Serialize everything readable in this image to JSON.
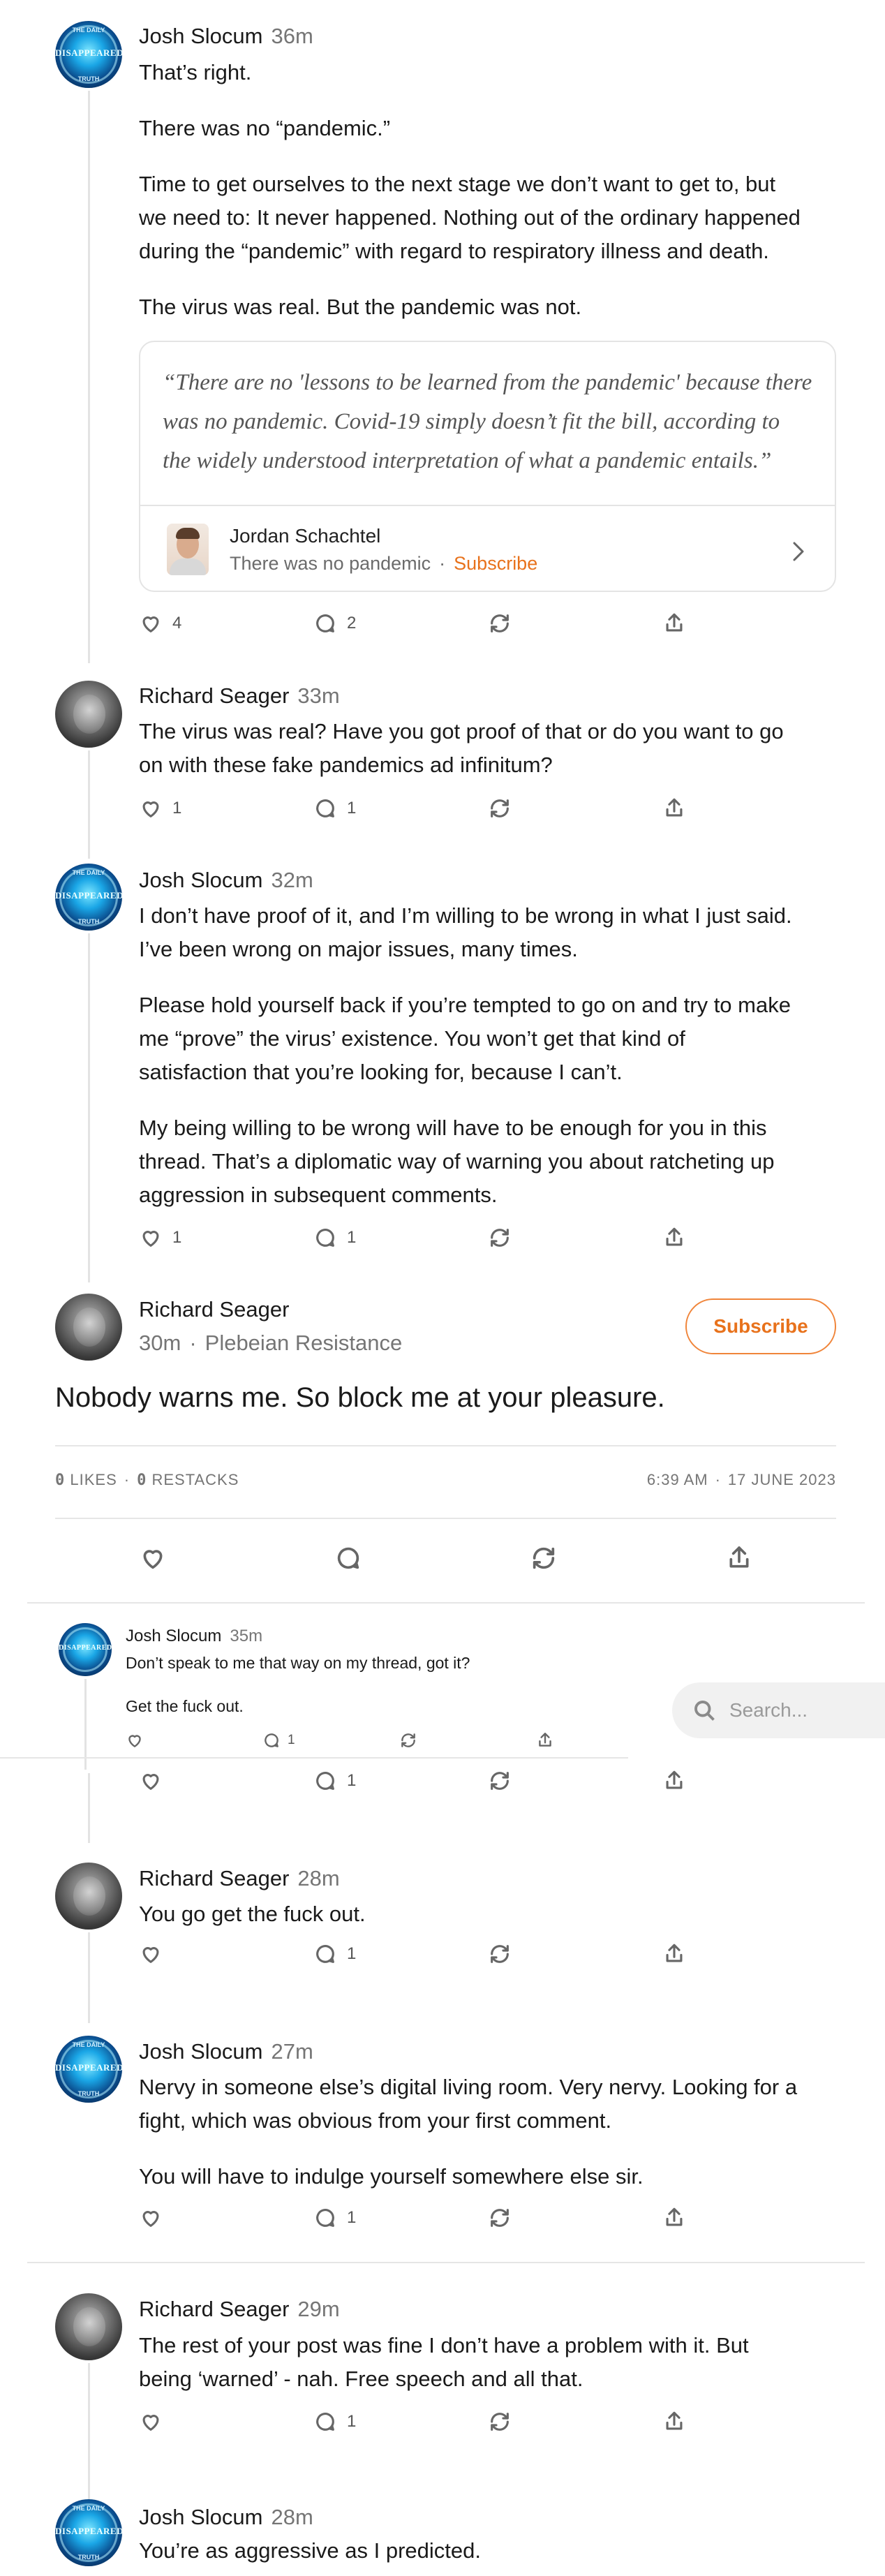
{
  "comments": [
    {
      "author": "Josh Slocum",
      "time": "36m",
      "paragraphs": [
        "That’s right.",
        "There was no “pandemic.”",
        "Time to get ourselves to the next stage we don’t want to get to, but",
        "we need to: It never happened. Nothing out of the ordinary happened",
        "during the “pandemic” with regard to respiratory illness and death.",
        "The virus was real. But the pandemic was not."
      ],
      "likes": "4",
      "replies": "2"
    },
    {
      "author": "Richard Seager",
      "time": "33m",
      "paragraphs": [
        "The virus was real? Have you got proof of that or do you want to go",
        "on with these fake pandemics ad infinitum?"
      ],
      "likes": "1",
      "replies": "1"
    },
    {
      "author": "Josh Slocum",
      "time": "32m",
      "paragraphs": [
        "I don’t have proof of it, and I’m willing to be wrong in what I just said.",
        "I’ve been wrong on major issues, many times.",
        "Please hold yourself back if you’re tempted to go on and try to make",
        "me “prove” the virus’ existence. You won’t get that kind of",
        "satisfaction that you’re looking for, because I can’t.",
        "My being willing to be wrong will have to be enough for you in this",
        "thread. That’s a diplomatic way of warning you about ratcheting up",
        "aggression in subsequent comments."
      ],
      "likes": "1",
      "replies": "1"
    }
  ],
  "quote": {
    "text_lines": [
      "“There are no 'lessons to be learned from the pandemic' because there",
      "was no pandemic. Covid-19 simply doesn’t fit the bill, according to",
      "the widely understood interpretation of what a pandemic entails.”"
    ],
    "author": "Jordan Schachtel",
    "publication": "There was no pandemic",
    "subscribe_label": "Subscribe"
  },
  "focused": {
    "author": "Richard Seager",
    "time": "30m",
    "publication": "Plebeian Resistance",
    "subscribe_label": "Subscribe",
    "text": "Nobody warns me. So block me at your pleasure.",
    "likes_count": "0",
    "likes_label": "LIKES",
    "restacks_count": "0",
    "restacks_label": "RESTACKS",
    "time_stamp": "6:39 AM",
    "date": "17 JUNE 2023"
  },
  "embedded": {
    "author": "Josh Slocum",
    "time": "35m",
    "line1": "Don’t speak to me that way on my thread, got it?",
    "line2": "Get the fuck out.",
    "replies": "1"
  },
  "search": {
    "placeholder": "Search..."
  },
  "lower": [
    {
      "replies": "1"
    },
    {
      "author": "Richard Seager",
      "time": "28m",
      "text": "You go get the fuck out.",
      "replies": "1"
    },
    {
      "author": "Josh Slocum",
      "time": "27m",
      "lines": [
        "Nervy in someone else’s digital living room. Very nervy. Looking for a",
        "fight, which was obvious from your first comment.",
        "You will have to indulge yourself somewhere else sir."
      ],
      "replies": "1"
    },
    {
      "author": "Richard Seager",
      "time": "29m",
      "lines": [
        "The rest of your post was fine I don’t have a problem with it. But",
        "being ‘warned’ - nah. Free speech and all that."
      ],
      "replies": "1"
    },
    {
      "author": "Josh Slocum",
      "time": "28m",
      "text": "You’re as aggressive as I predicted."
    }
  ],
  "icons": [
    "heart-icon",
    "comment-icon",
    "restack-icon",
    "share-icon",
    "search-icon",
    "chevron-right-icon"
  ],
  "colors": {
    "accent": "#e8721c",
    "text": "#1a1a1a",
    "muted": "#757575"
  }
}
